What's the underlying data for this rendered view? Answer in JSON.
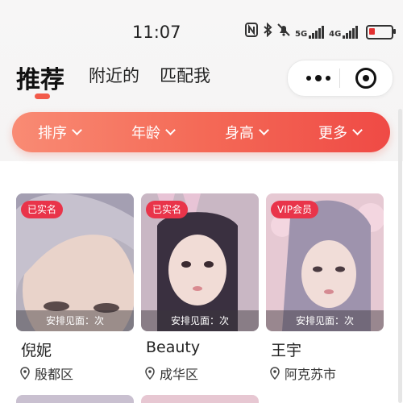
{
  "status_bar": {
    "time": "11:07",
    "icons": [
      "nfc-icon",
      "bluetooth-icon",
      "mute-icon",
      "signal-5g-icon",
      "signal-4g-icon",
      "battery-icon"
    ],
    "net1": "5G",
    "net2": "4G"
  },
  "tabs": [
    {
      "label": "推荐",
      "active": true
    },
    {
      "label": "附近的",
      "active": false
    },
    {
      "label": "匹配我",
      "active": false
    }
  ],
  "filters": [
    {
      "label": "排序"
    },
    {
      "label": "年龄"
    },
    {
      "label": "身高"
    },
    {
      "label": "更多"
    }
  ],
  "profiles": [
    {
      "name": "倪妮",
      "badge": "已实名",
      "meet_text": "安排见面：次",
      "location": "殷都区"
    },
    {
      "name": "Beauty",
      "badge": "已实名",
      "meet_text": "安排见面：次",
      "location": "成华区"
    },
    {
      "name": "王宇",
      "badge": "VIP会员",
      "meet_text": "安排见面：次",
      "location": "阿克苏市"
    }
  ],
  "colors": {
    "accent": "#f25a4a",
    "filter_gradient_start": "#f98b74",
    "filter_gradient_end": "#ef4a45",
    "badge": "#e9344a"
  }
}
